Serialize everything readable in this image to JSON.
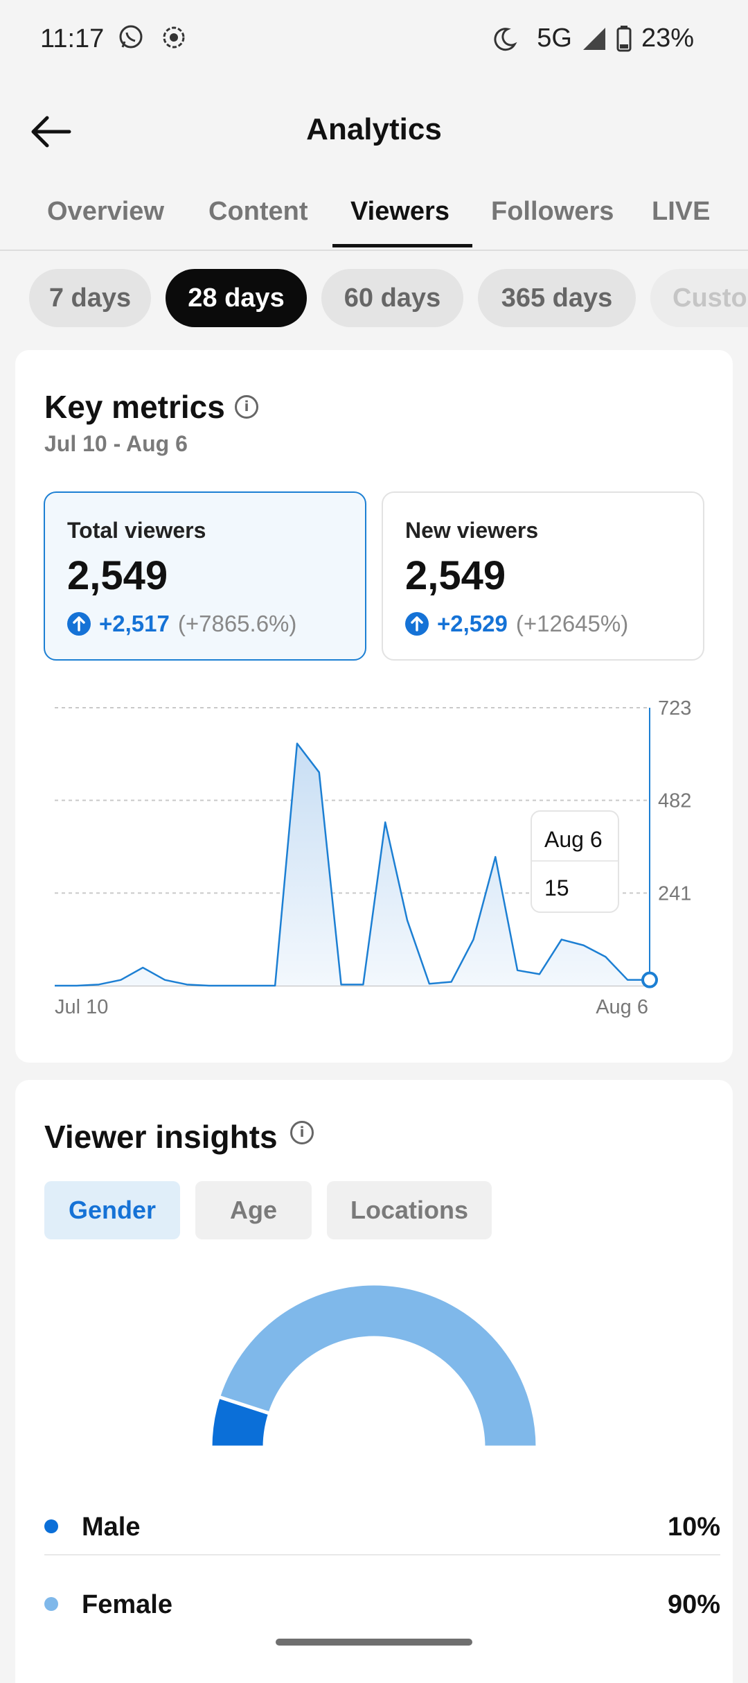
{
  "status_bar": {
    "time": "11:17",
    "network": "5G",
    "battery": "23%"
  },
  "header": {
    "title": "Analytics"
  },
  "tabs": [
    {
      "label": "Overview"
    },
    {
      "label": "Content"
    },
    {
      "label": "Viewers",
      "active": true
    },
    {
      "label": "Followers"
    },
    {
      "label": "LIVE"
    }
  ],
  "ranges": [
    {
      "label": "7 days"
    },
    {
      "label": "28 days",
      "active": true
    },
    {
      "label": "60 days"
    },
    {
      "label": "365 days"
    },
    {
      "label": "Custom"
    }
  ],
  "key_metrics": {
    "title": "Key metrics",
    "date_range": "Jul 10 - Aug 6",
    "total": {
      "label": "Total viewers",
      "value": "2,549",
      "delta": "+2,517",
      "pct": "(+7865.6%)"
    },
    "new": {
      "label": "New viewers",
      "value": "2,549",
      "delta": "+2,529",
      "pct": "(+12645%)"
    }
  },
  "chart_data": {
    "type": "area",
    "x_start_label": "Jul 10",
    "x_end_label": "Aug 6",
    "y_ticks": [
      241,
      482,
      723
    ],
    "ylim": [
      0,
      723
    ],
    "grid": true,
    "values": [
      0,
      0,
      3,
      15,
      47,
      15,
      3,
      0,
      0,
      0,
      0,
      630,
      555,
      3,
      3,
      425,
      170,
      5,
      10,
      120,
      335,
      40,
      30,
      120,
      105,
      75,
      15,
      15
    ],
    "tooltip": {
      "date": "Aug 6",
      "value": 15
    },
    "color": "#1c7fd3"
  },
  "insights": {
    "title": "Viewer insights",
    "tabs": [
      {
        "label": "Gender",
        "active": true
      },
      {
        "label": "Age"
      },
      {
        "label": "Locations"
      }
    ],
    "gender": [
      {
        "label": "Male",
        "pct": "10%",
        "color": "#0b6fd8",
        "value": 10
      },
      {
        "label": "Female",
        "pct": "90%",
        "color": "#7fb8ea",
        "value": 90
      }
    ]
  }
}
